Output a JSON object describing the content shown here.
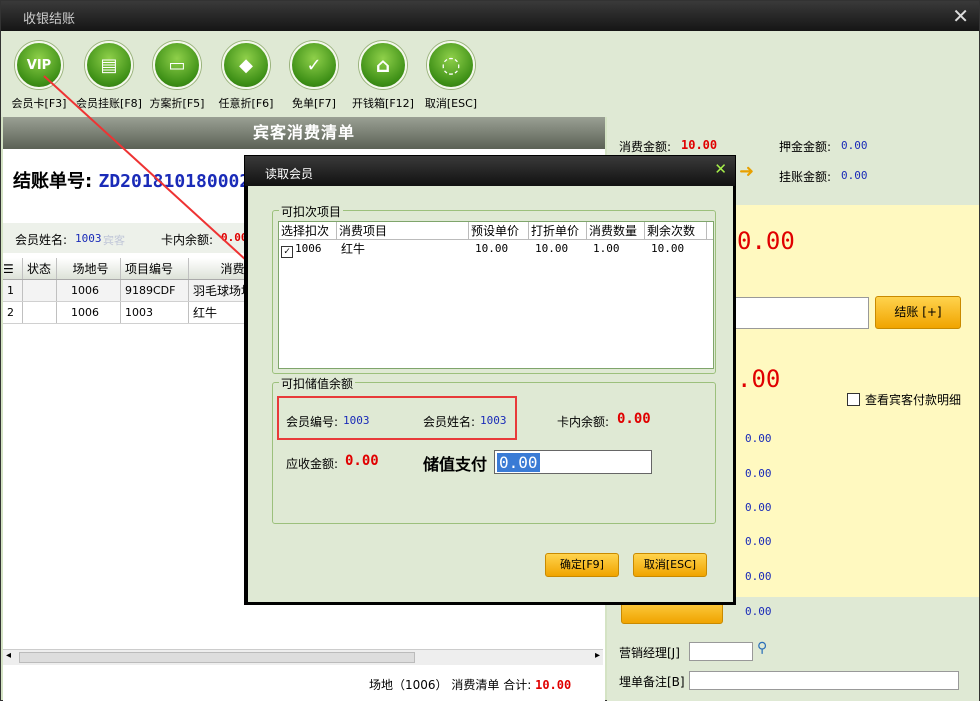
{
  "window": {
    "title": "收银结账",
    "close": "✕"
  },
  "toolbar": [
    {
      "label": "会员卡[F3]",
      "glyph": "VIP"
    },
    {
      "label": "会员挂账[F8]",
      "glyph": "▤"
    },
    {
      "label": "方案折[F5]",
      "glyph": "▭"
    },
    {
      "label": "任意折[F6]",
      "glyph": "◆"
    },
    {
      "label": "免单[F7]",
      "glyph": "✓"
    },
    {
      "label": "开钱箱[F12]",
      "glyph": "⌂"
    },
    {
      "label": "取消[ESC]",
      "glyph": "◌"
    }
  ],
  "left": {
    "header": "宾客消费清单",
    "bill_label": "结账单号:",
    "bill_no": "ZD2018101800022",
    "member_name_label": "会员姓名:",
    "member_name_value": "1003",
    "member_name_hint": "宾客",
    "card_balance_label": "卡内余额:",
    "card_balance_value": "0.00",
    "grid_headers": [
      "状态",
      "场地号",
      "项目编号",
      "消费"
    ],
    "grid_rows": [
      {
        "no": "1",
        "status": "",
        "site": "1006",
        "code": "9189CDF",
        "item": "羽毛球场地"
      },
      {
        "no": "2",
        "status": "",
        "site": "1006",
        "code": "1003",
        "item": "红牛"
      }
    ],
    "footer_site": "场地（1006）",
    "footer_list": "消费清单",
    "footer_total_label": "合计:",
    "footer_total_value": "10.00"
  },
  "right": {
    "consume_label": "消费金额:",
    "consume_value": "10.00",
    "deposit_label": "押金金额:",
    "deposit_value": "0.00",
    "credit_label": "挂账金额:",
    "credit_value": "0.00",
    "big_amount1": "0.00",
    "checkout_btn": "结账 [+]",
    "big_amount2": ".00",
    "view_detail": "查看宾客付款明细",
    "small_values": [
      "0.00",
      "0.00",
      "0.00",
      "0.00",
      "0.00",
      "0.00"
    ],
    "manager_label": "营销经理[J]",
    "remark_label": "埋单备注[B]"
  },
  "modal": {
    "title": "读取会员",
    "close": "✕",
    "group1_title": "可扣次项目",
    "list_headers": [
      "选择扣次",
      "消费项目",
      "预设单价",
      "打折单价",
      "消费数量",
      "剩余次数"
    ],
    "list_rows": [
      {
        "checked": "✓",
        "code": "1006",
        "item": "红牛",
        "preset": "10.00",
        "discount": "10.00",
        "qty": "1.00",
        "remain": "10.00"
      }
    ],
    "group2_title": "可扣储值余额",
    "member_no_label": "会员编号:",
    "member_no_value": "1003",
    "member_name_label": "会员姓名:",
    "member_name_value": "1003",
    "card_balance_label": "卡内余额:",
    "card_balance_value": "0.00",
    "receivable_label": "应收金额:",
    "receivable_value": "0.00",
    "stored_pay_label": "储值支付",
    "stored_pay_value": "0.00",
    "ok_btn": "确定[F9]",
    "cancel_btn": "取消[ESC]"
  }
}
